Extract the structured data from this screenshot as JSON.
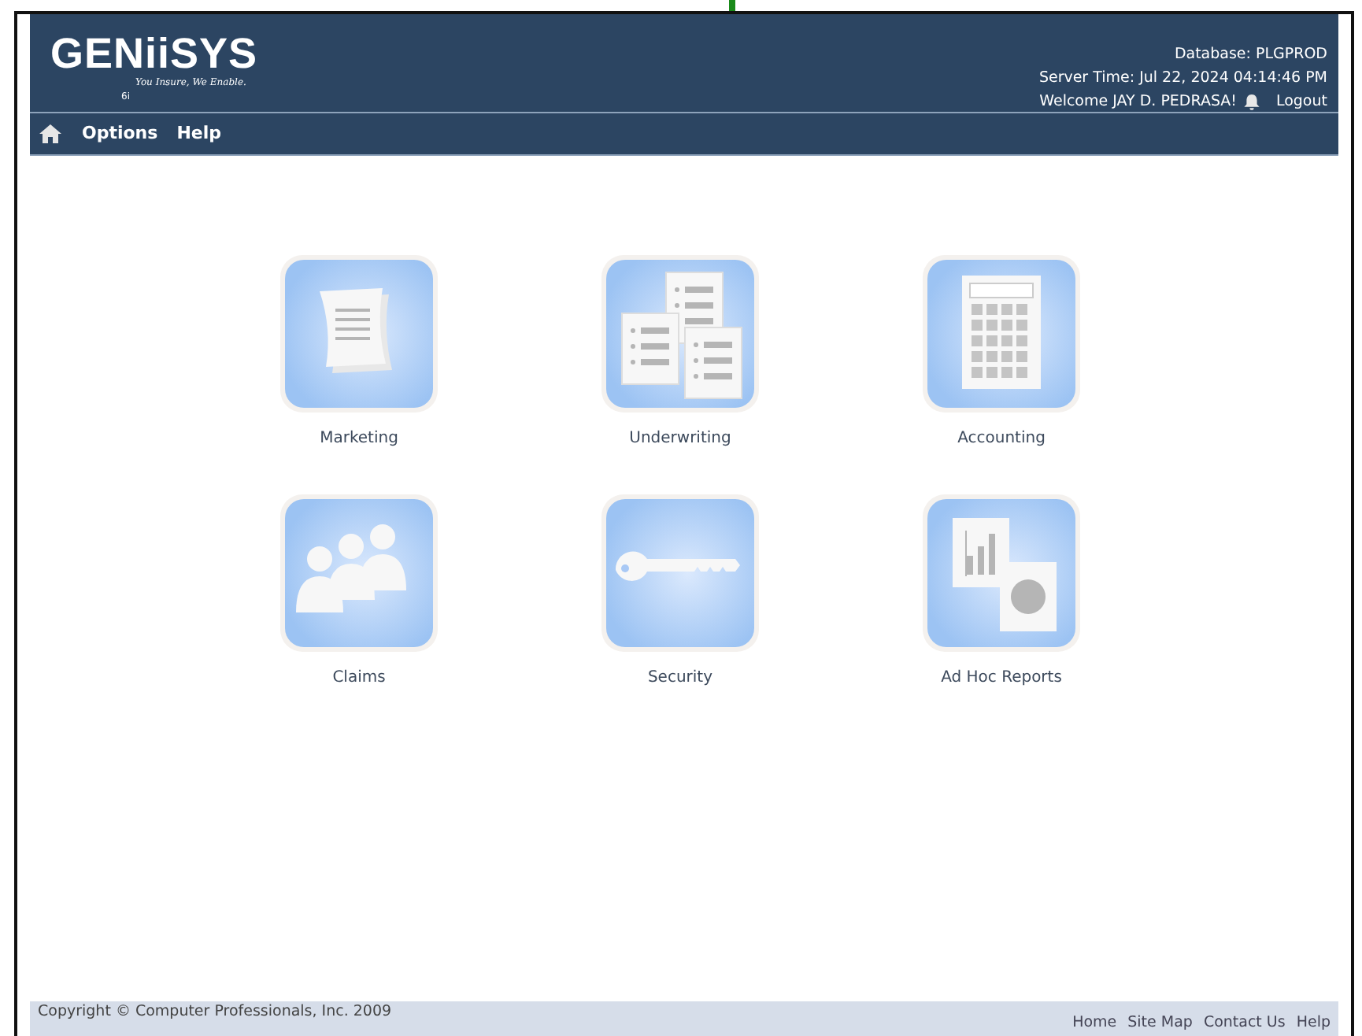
{
  "header": {
    "logo": "GENiiSYS",
    "tagline": "You Insure, We Enable.",
    "version": "6i",
    "database": "Database: PLGPROD",
    "server_time": "Server Time: Jul 22, 2024 04:14:46 PM",
    "welcome": "Welcome JAY D. PEDRASA!",
    "logout": "Logout"
  },
  "menu": [
    "Options",
    "Help"
  ],
  "modules": [
    {
      "kind": "papers",
      "label": "Marketing"
    },
    {
      "kind": "documents",
      "label": "Underwriting"
    },
    {
      "kind": "calculator",
      "label": "Accounting"
    },
    {
      "kind": "people",
      "label": "Claims"
    },
    {
      "kind": "key",
      "label": "Security"
    },
    {
      "kind": "reports",
      "label": "Ad Hoc Reports"
    }
  ],
  "footer": {
    "copyright": "Copyright © Computer Professionals, Inc. 2009",
    "links": [
      "Home",
      "Site Map",
      "Contact Us",
      "Help"
    ]
  }
}
